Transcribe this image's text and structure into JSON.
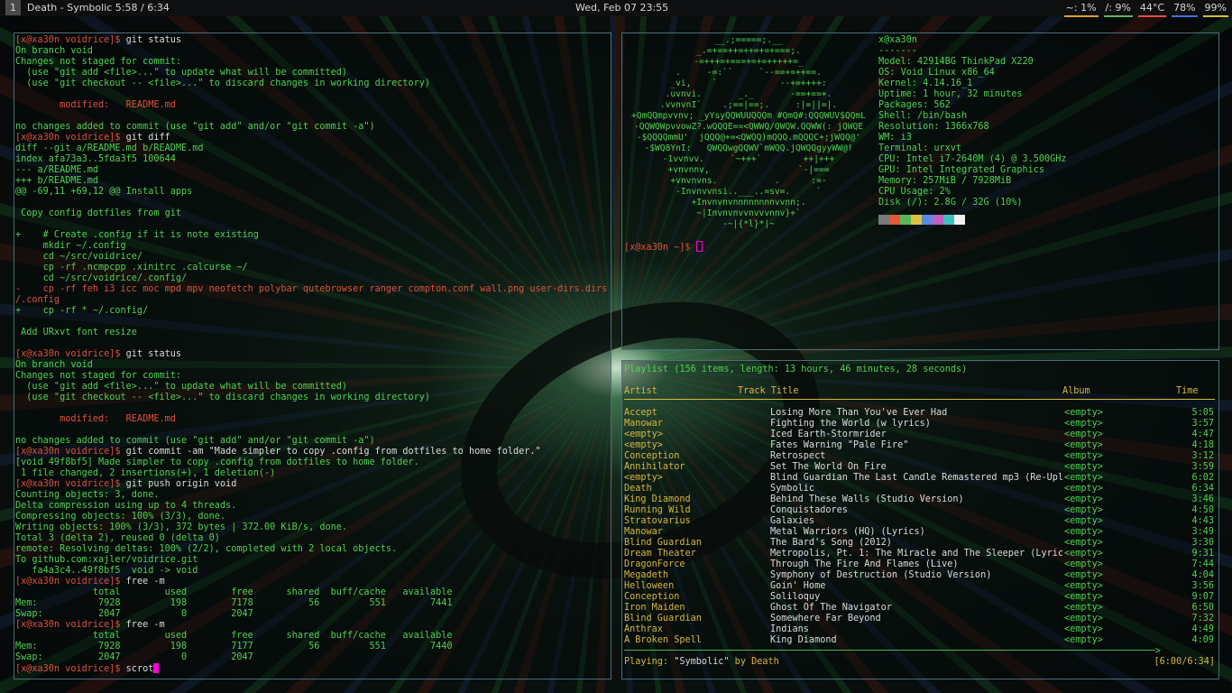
{
  "bar": {
    "workspace": "1",
    "window_title": "Death - Symbolic 5:58 / 6:34",
    "clock": "Wed, Feb 07 23:55",
    "stats": [
      {
        "label": "~: 1%",
        "color": "#e0a030"
      },
      {
        "label": "/: 9%",
        "color": "#5ab85a"
      },
      {
        "label": "44°C",
        "color": "#e05040"
      },
      {
        "label": "78%",
        "color": "#4070e0"
      },
      {
        "label": "99%",
        "color": "#d8c030"
      }
    ]
  },
  "terminal_left": {
    "lines": [
      [
        {
          "t": "[x@xa30n voidrice]$ ",
          "c": "r"
        },
        {
          "t": "git status",
          "c": "w"
        }
      ],
      [
        {
          "t": "On branch void",
          "c": "g"
        }
      ],
      [
        {
          "t": "Changes not staged for commit:",
          "c": "g"
        }
      ],
      [
        {
          "t": "  (use \"git add <file>...\" to update what will be committed)",
          "c": "g"
        }
      ],
      [
        {
          "t": "  (use \"git checkout -- <file>...\" to discard changes in working directory)",
          "c": "g"
        }
      ],
      [
        {
          "t": "",
          "c": "w"
        }
      ],
      [
        {
          "t": "        modified:   README.md",
          "c": "r"
        }
      ],
      [
        {
          "t": "",
          "c": "w"
        }
      ],
      [
        {
          "t": "no changes added to commit (use \"git add\" and/or \"git commit -a\")",
          "c": "g"
        }
      ],
      [
        {
          "t": "[x@xa30n voidrice]$ ",
          "c": "r"
        },
        {
          "t": "git diff",
          "c": "w"
        }
      ],
      [
        {
          "t": "diff --git a/README.md b/README.md",
          "c": "g"
        }
      ],
      [
        {
          "t": "index afa73a3..5fda3f5 100644",
          "c": "g"
        }
      ],
      [
        {
          "t": "--- a/README.md",
          "c": "g"
        }
      ],
      [
        {
          "t": "+++ b/README.md",
          "c": "g"
        }
      ],
      [
        {
          "t": "@@ -69,11 +69,12 @@ Install apps",
          "c": "g"
        }
      ],
      [
        {
          "t": "",
          "c": "w"
        }
      ],
      [
        {
          "t": " Copy config dotfiles from git",
          "c": "g"
        }
      ],
      [
        {
          "t": "",
          "c": "w"
        }
      ],
      [
        {
          "t": "+    # Create .config if it is note existing",
          "c": "g"
        }
      ],
      [
        {
          "t": "     mkdir ~/.config",
          "c": "g"
        }
      ],
      [
        {
          "t": "     cd ~/src/voidrice/",
          "c": "g"
        }
      ],
      [
        {
          "t": "     cp -rf .ncmpcpp .xinitrc .calcurse ~/",
          "c": "g"
        }
      ],
      [
        {
          "t": "     cd ~/src/voidrice/.config/",
          "c": "g"
        }
      ],
      [
        {
          "t": "-    cp -rf feh i3 icc moc mpd mpv neofetch polybar qutebrowser ranger compton.conf wall.png user-dirs.dirs ~",
          "c": "r"
        }
      ],
      [
        {
          "t": "/.config",
          "c": "r"
        }
      ],
      [
        {
          "t": "+    cp -rf * ~/.config/",
          "c": "g"
        }
      ],
      [
        {
          "t": "",
          "c": "w"
        }
      ],
      [
        {
          "t": " Add URxvt font resize",
          "c": "g"
        }
      ],
      [
        {
          "t": "",
          "c": "w"
        }
      ],
      [
        {
          "t": "[x@xa30n voidrice]$ ",
          "c": "r"
        },
        {
          "t": "git status",
          "c": "w"
        }
      ],
      [
        {
          "t": "On branch void",
          "c": "g"
        }
      ],
      [
        {
          "t": "Changes not staged for commit:",
          "c": "g"
        }
      ],
      [
        {
          "t": "  (use \"git add <file>...\" to update what will be committed)",
          "c": "g"
        }
      ],
      [
        {
          "t": "  (use \"git checkout -- <file>...\" to discard changes in working directory)",
          "c": "g"
        }
      ],
      [
        {
          "t": "",
          "c": "w"
        }
      ],
      [
        {
          "t": "        modified:   README.md",
          "c": "r"
        }
      ],
      [
        {
          "t": "",
          "c": "w"
        }
      ],
      [
        {
          "t": "no changes added to commit (use \"git add\" and/or \"git commit -a\")",
          "c": "g"
        }
      ],
      [
        {
          "t": "[x@xa30n voidrice]$ ",
          "c": "r"
        },
        {
          "t": "git commit -am \"Made simpler to copy .config from dotfiles to home folder.\"",
          "c": "w"
        }
      ],
      [
        {
          "t": "[void 49f8bf5] Made simpler to copy .config from dotfiles to home folder.",
          "c": "g"
        }
      ],
      [
        {
          "t": " 1 file changed, 2 insertions(+), 1 deletion(-)",
          "c": "g"
        }
      ],
      [
        {
          "t": "[x@xa30n voidrice]$ ",
          "c": "r"
        },
        {
          "t": "git push origin void",
          "c": "w"
        }
      ],
      [
        {
          "t": "Counting objects: 3, done.",
          "c": "g"
        }
      ],
      [
        {
          "t": "Delta compression using up to 4 threads.",
          "c": "g"
        }
      ],
      [
        {
          "t": "Compressing objects: 100% (3/3), done.",
          "c": "g"
        }
      ],
      [
        {
          "t": "Writing objects: 100% (3/3), 372 bytes | 372.00 KiB/s, done.",
          "c": "g"
        }
      ],
      [
        {
          "t": "Total 3 (delta 2), reused 0 (delta 0)",
          "c": "g"
        }
      ],
      [
        {
          "t": "remote: Resolving deltas: 100% (2/2), completed with 2 local objects.",
          "c": "g"
        }
      ],
      [
        {
          "t": "To github.com:xajler/voidrice.git",
          "c": "g"
        }
      ],
      [
        {
          "t": "   fa4a3c4..49f8bf5  void -> void",
          "c": "g"
        }
      ],
      [
        {
          "t": "[x@xa30n voidrice]$ ",
          "c": "r"
        },
        {
          "t": "free -m",
          "c": "w"
        }
      ],
      [
        {
          "t": "              total        used        free      shared  buff/cache   available",
          "c": "g"
        }
      ],
      [
        {
          "t": "Mem:           7928         198        7178          56         551        7441",
          "c": "g"
        }
      ],
      [
        {
          "t": "Swap:          2047           0        2047",
          "c": "g"
        }
      ],
      [
        {
          "t": "[x@xa30n voidrice]$ ",
          "c": "r"
        },
        {
          "t": "free -m",
          "c": "w"
        }
      ],
      [
        {
          "t": "              total        used        free      shared  buff/cache   available",
          "c": "g"
        }
      ],
      [
        {
          "t": "Mem:           7928         198        7177          56         551        7440",
          "c": "g"
        }
      ],
      [
        {
          "t": "Swap:          2047           0        2047",
          "c": "g"
        }
      ],
      [
        {
          "t": "[x@xa30n voidrice]$ ",
          "c": "r"
        },
        {
          "t": "scrot",
          "c": "w"
        }
      ]
    ]
  },
  "neofetch": {
    "ascii": [
      "__.;=====;.__",
      "_.=+==++=++=+=+===;.",
      "-=+++=+===+=+=+++++=_",
      ".     -=:``     `--==+=++==.",
      "_vi,    `            --+=++++:",
      ".uvnvi.       _._       -==+==+.",
      ".vvnvnI`    .;==|==;.     :|=||=|.",
      "+QmQQmpvvnv; _yYsyQQWUUQQQm #QmQ#:QQQWUV$QQmL",
      "-QQWQWpvvowZ?.wQQQE==<QWWQ/QWQW.QQWW(: jQWQE",
      "-$QQQQmmU'  jQQQ@+=<QWQQ)mQQQ.mQQQC+;jWQQ@'",
      "-$WQ8YnI:   QWQQwgQQWV`mWQQ.jQWQQgyyWW@!",
      "-1vvnvv.     `~+++`        ++|+++",
      "+vnvnnv,                 `-|===",
      "+vnvnvns.           .      :=-",
      "-Invnvvnsi..___..=sv=.     `",
      "+Invnvnvnnnnnnnnvvnn;.",
      "~|Invnvnvvnvvvnnv}+`",
      "-~|{*l}*|~"
    ],
    "info": [
      {
        "k": "",
        "v": "x@xa30n"
      },
      {
        "k": "",
        "v": "-------"
      },
      {
        "k": "Model",
        "v": "42914BG ThinkPad X220"
      },
      {
        "k": "OS",
        "v": "Void Linux x86_64"
      },
      {
        "k": "Kernel",
        "v": "4.14.16_1"
      },
      {
        "k": "Uptime",
        "v": "1 hour, 32 minutes"
      },
      {
        "k": "Packages",
        "v": "562"
      },
      {
        "k": "Shell",
        "v": "/bin/bash"
      },
      {
        "k": "Resolution",
        "v": "1366x768"
      },
      {
        "k": "WM",
        "v": "i3"
      },
      {
        "k": "Terminal",
        "v": "urxvt"
      },
      {
        "k": "CPU",
        "v": "Intel i7-2640M (4) @ 3.500GHz"
      },
      {
        "k": "GPU",
        "v": "Intel Integrated Graphics"
      },
      {
        "k": "Memory",
        "v": "257MiB / 7928MiB"
      },
      {
        "k": "CPU Usage",
        "v": "2%"
      },
      {
        "k": "Disk (/)",
        "v": "2.8G / 32G (10%)"
      }
    ],
    "colors": [
      "#7a7a7a",
      "#e05a3a",
      "#5ab85a",
      "#e0c040",
      "#5a8ae0",
      "#c060c0",
      "#40c0c0",
      "#f0f0f0"
    ],
    "prompt": "[x@xa30n ~]$ "
  },
  "ncmpcpp": {
    "playlist_title": "Playlist (156 items, length: 13 hours, 46 minutes, 28 seconds)",
    "headers": {
      "artist": "Artist",
      "title": "Track Title",
      "album": "Album",
      "time": "Time"
    },
    "rows": [
      {
        "artist": "Accept",
        "title": "Losing More Than You've Ever Had",
        "album": "<empty>",
        "time": "5:05"
      },
      {
        "artist": "Manowar",
        "title": "Fighting the World (w lyrics)",
        "album": "<empty>",
        "time": "3:57"
      },
      {
        "artist": "<empty>",
        "title": "Iced Earth-Stormrider",
        "album": "<empty>",
        "time": "4:47"
      },
      {
        "artist": "<empty>",
        "title": "Fates Warning \"Pale Fire\"",
        "album": "<empty>",
        "time": "4:18"
      },
      {
        "artist": "Conception",
        "title": "Retrospect",
        "album": "<empty>",
        "time": "3:12"
      },
      {
        "artist": "Annihilator",
        "title": "Set The World On Fire",
        "album": "<empty>",
        "time": "3:59"
      },
      {
        "artist": "<empty>",
        "title": "Blind Guardian The Last Candle Remastered mp3 (Re-Upl",
        "album": "<empty>",
        "time": "6:02"
      },
      {
        "artist": "Death",
        "title": "Symbolic",
        "album": "<empty>",
        "time": "6:34"
      },
      {
        "artist": "King Diamond",
        "title": "Behind These Walls (Studio Version)",
        "album": "<empty>",
        "time": "3:46"
      },
      {
        "artist": "Running Wild",
        "title": "Conquistadores",
        "album": "<empty>",
        "time": "4:50"
      },
      {
        "artist": "Stratovarius",
        "title": "Galaxies",
        "album": "<empty>",
        "time": "4:43"
      },
      {
        "artist": "Manowar",
        "title": "Metal Warriors (HQ) (Lyrics)",
        "album": "<empty>",
        "time": "3:49"
      },
      {
        "artist": "Blind Guardian",
        "title": "The Bard's Song (2012)",
        "album": "<empty>",
        "time": "3:30"
      },
      {
        "artist": "Dream Theater",
        "title": "Metropolis, Pt. 1: The Miracle and The Sleeper (Lyric",
        "album": "<empty>",
        "time": "9:31"
      },
      {
        "artist": "DragonForce",
        "title": "Through The Fire And Flames (Live)",
        "album": "<empty>",
        "time": "7:44"
      },
      {
        "artist": "Megadeth",
        "title": "Symphony of Destruction (Studio Version)",
        "album": "<empty>",
        "time": "4:04"
      },
      {
        "artist": "Helloween",
        "title": "Goin' Home",
        "album": "<empty>",
        "time": "3:56"
      },
      {
        "artist": "Conception",
        "title": "Soliloquy",
        "album": "<empty>",
        "time": "9:07"
      },
      {
        "artist": "Iron Maiden",
        "title": "Ghost Of The Navigator",
        "album": "<empty>",
        "time": "6:50"
      },
      {
        "artist": "Blind Guardian",
        "title": "Somewhere Far Beyond",
        "album": "<empty>",
        "time": "7:32"
      },
      {
        "artist": "Anthrax",
        "title": "Indians",
        "album": "<empty>",
        "time": "4:49"
      },
      {
        "artist": "A Broken Spell",
        "title": "King Diamond",
        "album": "<empty>",
        "time": "4:09"
      }
    ],
    "progress_bar": "────────────────────────────────────────────────────────────────────────────────────────────────>",
    "playing_prefix": "Playing: ",
    "playing_title": "\"Symbolic\"",
    "playing_by": " by Death",
    "elapsed": "[6:00/6:34]"
  }
}
